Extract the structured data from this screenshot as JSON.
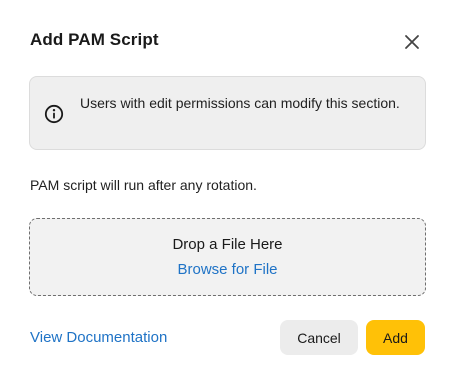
{
  "dialog": {
    "title": "Add PAM Script",
    "close_icon": "close-icon"
  },
  "info_banner": {
    "icon": "info-icon",
    "text": "Users with edit permissions can modify this section."
  },
  "description": "PAM script will run after any rotation.",
  "dropzone": {
    "title": "Drop a File Here",
    "browse_label": "Browse for File"
  },
  "footer": {
    "doc_link": "View Documentation",
    "cancel_label": "Cancel",
    "add_label": "Add"
  },
  "colors": {
    "accent_link": "#1f73c6",
    "primary_button": "#ffc107",
    "secondary_button": "#ececec",
    "info_background": "#efefef"
  }
}
